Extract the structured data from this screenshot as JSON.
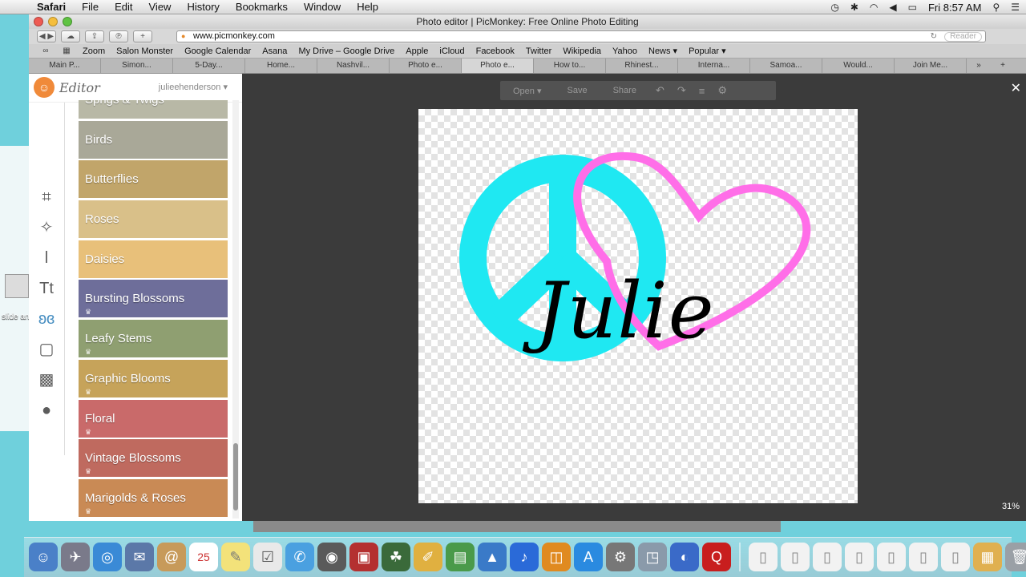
{
  "menubar": {
    "app": "Safari",
    "items": [
      "File",
      "Edit",
      "View",
      "History",
      "Bookmarks",
      "Window",
      "Help"
    ],
    "clock": "Fri 8:57 AM"
  },
  "desktop": {
    "icon_label": "slide andre"
  },
  "browser": {
    "window_title": "Photo editor | PicMonkey: Free Online Photo Editing",
    "url": "www.picmonkey.com",
    "reader": "Reader",
    "bookmarks": [
      "Zoom",
      "Salon Monster",
      "Google Calendar",
      "Asana",
      "My Drive – Google Drive",
      "Apple",
      "iCloud",
      "Facebook",
      "Twitter",
      "Wikipedia",
      "Yahoo",
      "News ▾",
      "Popular ▾"
    ],
    "tabs": [
      "Main P...",
      "Simon...",
      "5-Day...",
      "Home...",
      "Nashvil...",
      "Photo e...",
      "Photo e...",
      "How to...",
      "Rhinest...",
      "Interna...",
      "Samoa...",
      "Would...",
      "Join Me..."
    ]
  },
  "editor": {
    "logo": "Editor",
    "user": "julieehenderson ▾",
    "actions": {
      "open": "Open ▾",
      "save": "Save",
      "share": "Share"
    },
    "zoom": "31%",
    "items": [
      {
        "label": "Sprigs & Twigs",
        "color": "#b8b8a6",
        "premium": false
      },
      {
        "label": "Birds",
        "color": "#a9a898",
        "premium": false
      },
      {
        "label": "Butterflies",
        "color": "#c1a56a",
        "premium": false
      },
      {
        "label": "Roses",
        "color": "#d9c089",
        "premium": false
      },
      {
        "label": "Daisies",
        "color": "#e8c07a",
        "premium": false
      },
      {
        "label": "Bursting Blossoms",
        "color": "#6e6e9a",
        "premium": true
      },
      {
        "label": "Leafy Stems",
        "color": "#8f9f71",
        "premium": true
      },
      {
        "label": "Graphic Blooms",
        "color": "#c6a35a",
        "premium": true
      },
      {
        "label": "Floral",
        "color": "#c96a6a",
        "premium": true
      },
      {
        "label": "Vintage Blossoms",
        "color": "#bf6a5f",
        "premium": true
      },
      {
        "label": "Marigolds & Roses",
        "color": "#c98a55",
        "premium": true
      }
    ],
    "canvas_text": "Julie",
    "colors": {
      "peace": "#1fe8f2",
      "heart": "#ff6ee8",
      "text": "#000000"
    }
  },
  "dock": {
    "calendar_day": "25"
  }
}
